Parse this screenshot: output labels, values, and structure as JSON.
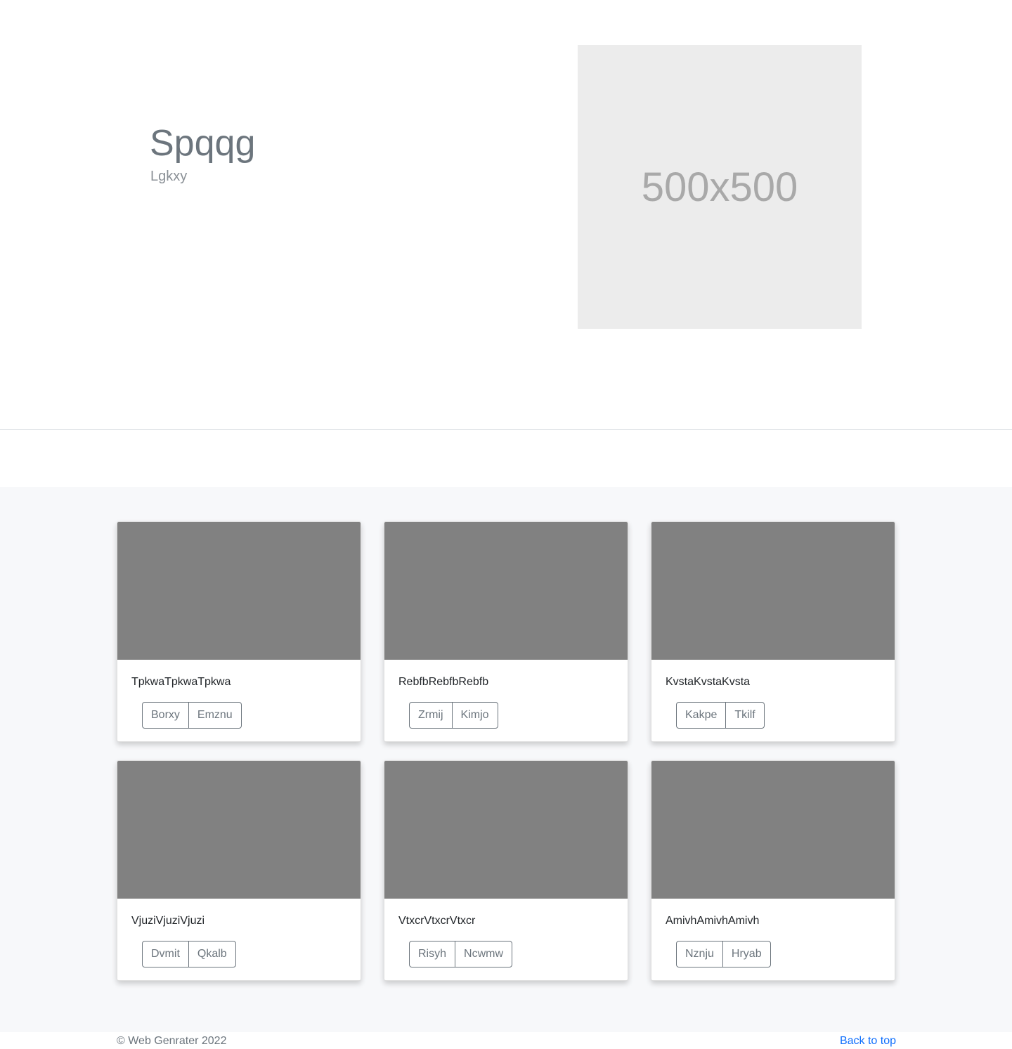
{
  "hero": {
    "title": "Spqqg",
    "subtitle": "Lgkxy",
    "image_label": "500x500"
  },
  "album": {
    "cards": [
      {
        "text": "TpkwaTpkwaTpkwa",
        "buttons": [
          "Borxy",
          "Emznu"
        ]
      },
      {
        "text": "RebfbRebfbRebfb",
        "buttons": [
          "Zrmij",
          "Kimjo"
        ]
      },
      {
        "text": "KvstaKvstaKvsta",
        "buttons": [
          "Kakpe",
          "Tkilf"
        ]
      },
      {
        "text": "VjuziVjuziVjuzi",
        "buttons": [
          "Dvmit",
          "Qkalb"
        ]
      },
      {
        "text": "VtxcrVtxcrVtxcr",
        "buttons": [
          "Risyh",
          "Ncwmw"
        ]
      },
      {
        "text": "AmivhAmivhAmivh",
        "buttons": [
          "Nznju",
          "Hryab"
        ]
      }
    ]
  },
  "footer": {
    "copyright": "© Web Genrater 2022",
    "back_to_top": "Back to top"
  },
  "colors": {
    "thumbnail": "#818181",
    "placeholder_bg": "#ececec",
    "album_bg": "#f7f8fa",
    "link": "#0d6efd",
    "muted": "#6c757d"
  }
}
